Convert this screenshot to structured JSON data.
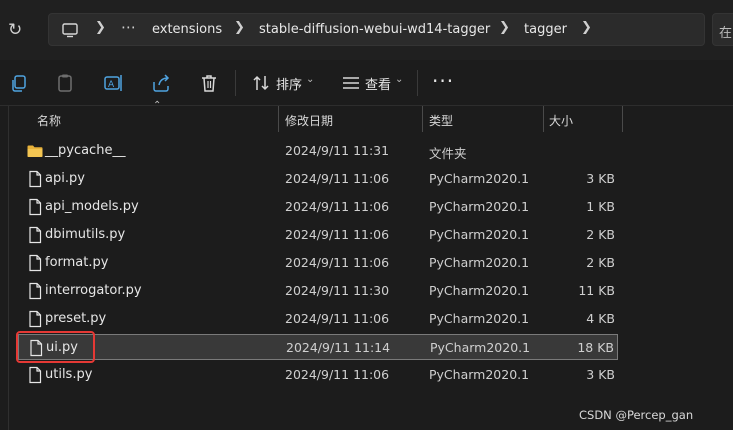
{
  "addressbar": {
    "ellipsis": "⋯",
    "crumbs": [
      "extensions",
      "stable-diffusion-webui-wd14-tagger",
      "tagger"
    ],
    "search_stub_text": "在"
  },
  "toolbar": {
    "sort_label": "排序",
    "view_label": "查看",
    "more_label": "···"
  },
  "columns": {
    "name": "名称",
    "modified": "修改日期",
    "type": "类型",
    "size": "大小"
  },
  "files": [
    {
      "name": "__pycache__",
      "modified": "2024/9/11 11:31",
      "type": "文件夹",
      "size": "",
      "kind": "folder",
      "selected": false
    },
    {
      "name": "api.py",
      "modified": "2024/9/11 11:06",
      "type": "PyCharm2020.1",
      "size": "3 KB",
      "kind": "file",
      "selected": false
    },
    {
      "name": "api_models.py",
      "modified": "2024/9/11 11:06",
      "type": "PyCharm2020.1",
      "size": "1 KB",
      "kind": "file",
      "selected": false
    },
    {
      "name": "dbimutils.py",
      "modified": "2024/9/11 11:06",
      "type": "PyCharm2020.1",
      "size": "2 KB",
      "kind": "file",
      "selected": false
    },
    {
      "name": "format.py",
      "modified": "2024/9/11 11:06",
      "type": "PyCharm2020.1",
      "size": "2 KB",
      "kind": "file",
      "selected": false
    },
    {
      "name": "interrogator.py",
      "modified": "2024/9/11 11:30",
      "type": "PyCharm2020.1",
      "size": "11 KB",
      "kind": "file",
      "selected": false
    },
    {
      "name": "preset.py",
      "modified": "2024/9/11 11:06",
      "type": "PyCharm2020.1",
      "size": "4 KB",
      "kind": "file",
      "selected": false
    },
    {
      "name": "ui.py",
      "modified": "2024/9/11 11:14",
      "type": "PyCharm2020.1",
      "size": "18 KB",
      "kind": "file",
      "selected": true
    },
    {
      "name": "utils.py",
      "modified": "2024/9/11 11:06",
      "type": "PyCharm2020.1",
      "size": "3 KB",
      "kind": "file",
      "selected": false
    }
  ],
  "watermark": "CSDN @Percep_gan",
  "colors": {
    "background": "#1c1c1c",
    "selection": "#393939",
    "highlight_box": "#e53935",
    "folder": "#e8b23a"
  }
}
